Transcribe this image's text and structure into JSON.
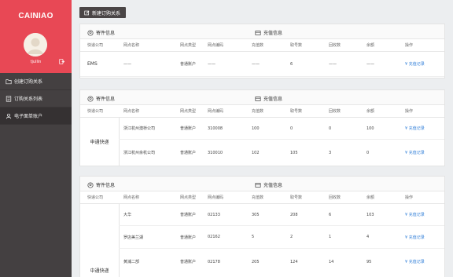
{
  "brand": {
    "logo": "CAINIAO",
    "username": "tjullin"
  },
  "sidebar": {
    "items": [
      {
        "label": "创建订购关系",
        "icon": "folder-icon",
        "active": false
      },
      {
        "label": "订购关系列表",
        "icon": "list-icon",
        "active": false
      },
      {
        "label": "电子面单账户",
        "icon": "user-icon",
        "active": true
      }
    ]
  },
  "toolbar": {
    "new_label": "新建订购关系"
  },
  "sections": {
    "sender": "寄件信息",
    "recharge": "充值信息"
  },
  "columns": {
    "company": "快递公司",
    "branch_name": "网点名称",
    "branch_type": "网点类型",
    "branch_code": "网点编码",
    "recharge": "充值数",
    "fetched": "取号数",
    "recycled": "回收数",
    "balance": "余额",
    "action": "操作"
  },
  "action_label": "¥ 充值记录",
  "cards": [
    {
      "company": "EMS",
      "rows": [
        {
          "branch_name": "——",
          "branch_type": "普通账户",
          "branch_code": "——",
          "recharge": "——",
          "fetched": "6",
          "recycled": "——",
          "balance": "——"
        }
      ]
    },
    {
      "company": "申通快递",
      "rows": [
        {
          "branch_name": "浙江杭州澳桥公司",
          "branch_type": "普通账户",
          "branch_code": "310008",
          "recharge": "100",
          "fetched": "0",
          "recycled": "0",
          "balance": "100"
        },
        {
          "branch_name": "浙江杭州余杭公司",
          "branch_type": "普通账户",
          "branch_code": "310010",
          "recharge": "102",
          "fetched": "105",
          "recycled": "3",
          "balance": "0"
        }
      ]
    },
    {
      "company": "中通快递",
      "rows": [
        {
          "branch_name": "大华",
          "branch_type": "普通账户",
          "branch_code": "02133",
          "recharge": "305",
          "fetched": "208",
          "recycled": "6",
          "balance": "103"
        },
        {
          "branch_name": "罗店美兰湖",
          "branch_type": "普通账户",
          "branch_code": "02162",
          "recharge": "5",
          "fetched": "2",
          "recycled": "1",
          "balance": "4"
        },
        {
          "branch_name": "黄浦二部",
          "branch_type": "普通账户",
          "branch_code": "02178",
          "recharge": "205",
          "fetched": "124",
          "recycled": "14",
          "balance": "95"
        }
      ]
    }
  ]
}
